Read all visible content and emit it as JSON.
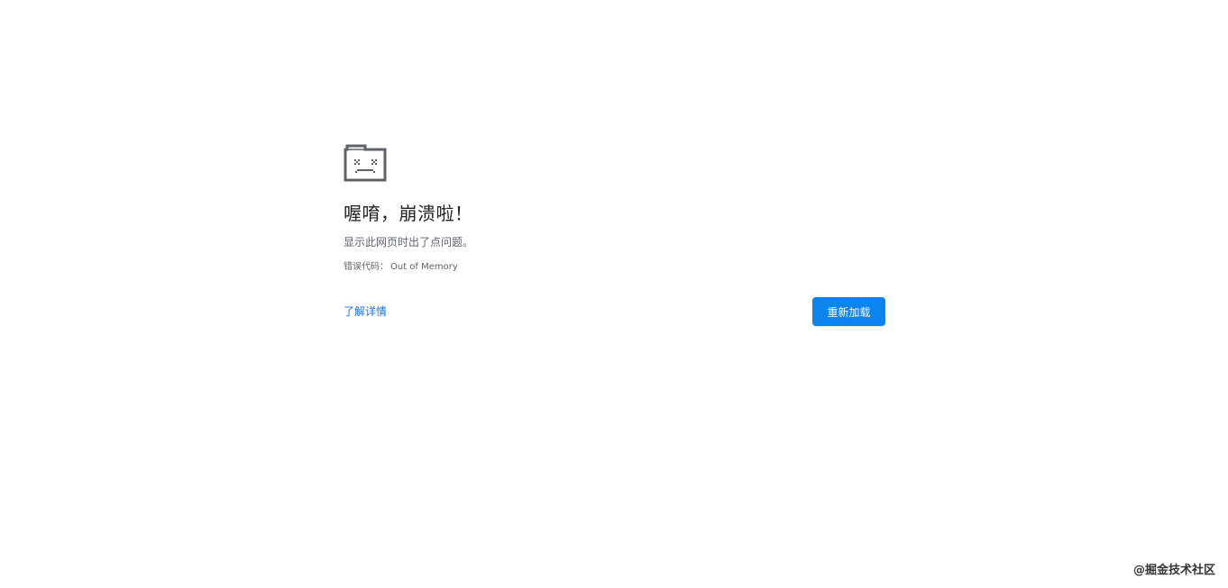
{
  "icon": "sad-tab-icon",
  "heading": "喔唷，崩溃啦！",
  "message": "显示此网页时出了点问题。",
  "error": {
    "label": "错误代码：",
    "code": "Out of Memory"
  },
  "actions": {
    "learn_more": "了解详情",
    "reload": "重新加载"
  },
  "watermark": "@掘金技术社区",
  "colors": {
    "accent": "#0b84ed",
    "link": "#1a73e8",
    "text": "#202124",
    "secondary": "#5f6368",
    "icon": "#5f6368"
  }
}
